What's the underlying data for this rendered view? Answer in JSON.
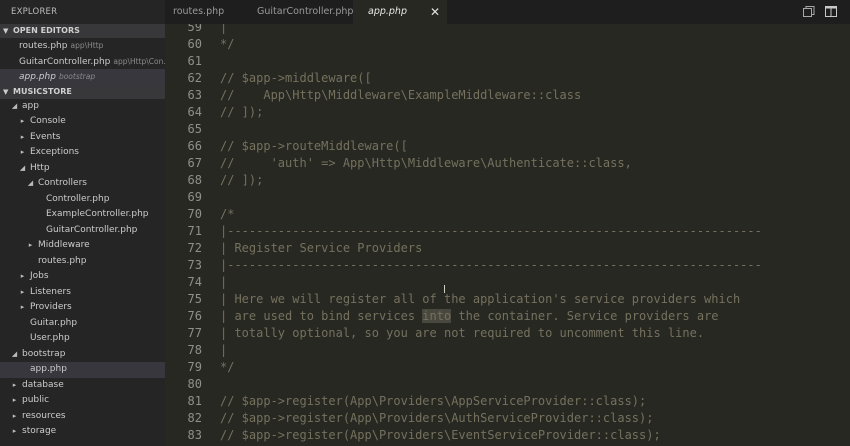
{
  "sidebar": {
    "title": "EXPLORER",
    "open_editors": {
      "header": "OPEN EDITORS",
      "items": [
        {
          "name": "routes.php",
          "path": "app\\Http",
          "active": false
        },
        {
          "name": "GuitarController.php",
          "path": "app\\Http\\Con...",
          "active": false
        },
        {
          "name": "app.php",
          "path": "bootstrap",
          "active": true
        }
      ]
    },
    "project": {
      "header": "MUSICSTORE",
      "items": [
        {
          "label": "app",
          "depth": 0,
          "caret": "open",
          "id": "app"
        },
        {
          "label": "Console",
          "depth": 1,
          "caret": "closed",
          "id": "console"
        },
        {
          "label": "Events",
          "depth": 1,
          "caret": "closed",
          "id": "events"
        },
        {
          "label": "Exceptions",
          "depth": 1,
          "caret": "closed",
          "id": "exceptions"
        },
        {
          "label": "Http",
          "depth": 1,
          "caret": "open",
          "id": "http"
        },
        {
          "label": "Controllers",
          "depth": 2,
          "caret": "open",
          "id": "controllers"
        },
        {
          "label": "Controller.php",
          "depth": 3,
          "caret": "none",
          "id": "controller-php"
        },
        {
          "label": "ExampleController.php",
          "depth": 3,
          "caret": "none",
          "id": "examplecontroller-php"
        },
        {
          "label": "GuitarController.php",
          "depth": 3,
          "caret": "none",
          "id": "guitarcontroller-php"
        },
        {
          "label": "Middleware",
          "depth": 2,
          "caret": "closed",
          "id": "middleware"
        },
        {
          "label": "routes.php",
          "depth": 2,
          "caret": "none",
          "id": "routes-php"
        },
        {
          "label": "Jobs",
          "depth": 1,
          "caret": "closed",
          "id": "jobs"
        },
        {
          "label": "Listeners",
          "depth": 1,
          "caret": "closed",
          "id": "listeners"
        },
        {
          "label": "Providers",
          "depth": 1,
          "caret": "closed",
          "id": "providers"
        },
        {
          "label": "Guitar.php",
          "depth": 1,
          "caret": "none",
          "id": "guitar-php"
        },
        {
          "label": "User.php",
          "depth": 1,
          "caret": "none",
          "id": "user-php"
        },
        {
          "label": "bootstrap",
          "depth": 0,
          "caret": "open",
          "id": "bootstrap"
        },
        {
          "label": "app.php",
          "depth": 1,
          "caret": "none",
          "id": "app-php",
          "selected": true
        },
        {
          "label": "database",
          "depth": 0,
          "caret": "closed",
          "id": "database"
        },
        {
          "label": "public",
          "depth": 0,
          "caret": "closed",
          "id": "public"
        },
        {
          "label": "resources",
          "depth": 0,
          "caret": "closed",
          "id": "resources"
        },
        {
          "label": "storage",
          "depth": 0,
          "caret": "closed",
          "id": "storage"
        }
      ]
    }
  },
  "tabs": [
    {
      "label": "routes.php",
      "active": false
    },
    {
      "label": "GuitarController.php",
      "active": false
    },
    {
      "label": "app.php",
      "active": true
    }
  ],
  "tab_close_glyph": "✕",
  "toolbar_icons": [
    "split-copy-icon",
    "split-editor-icon"
  ],
  "editor": {
    "first_line_number": 59,
    "highlight_word": "into",
    "lines": [
      "|",
      "*/",
      "",
      "// $app->middleware([",
      "//    App\\Http\\Middleware\\ExampleMiddleware::class",
      "// ]);",
      "",
      "// $app->routeMiddleware([",
      "//     'auth' => App\\Http\\Middleware\\Authenticate::class,",
      "// ]);",
      "",
      "/*",
      "|--------------------------------------------------------------------------",
      "| Register Service Providers",
      "|--------------------------------------------------------------------------",
      "|",
      "| Here we will register all of the application's service providers which",
      "| are used to bind services into the container. Service providers are",
      "| totally optional, so you are not required to uncomment this line.",
      "|",
      "*/",
      "",
      "// $app->register(App\\Providers\\AppServiceProvider::class);",
      "// $app->register(App\\Providers\\AuthServiceProvider::class);",
      "// $app->register(App\\Providers\\EventServiceProvider::class);"
    ]
  },
  "colors": {
    "editor_bg": "#272822",
    "sidebar_bg": "#252526",
    "comment": "#75715e",
    "line_number": "#8f908a"
  }
}
